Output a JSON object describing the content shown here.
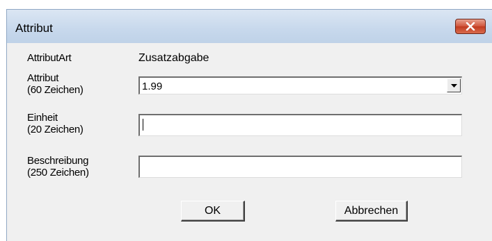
{
  "window": {
    "title": "Attribut",
    "close_icon": "close-icon"
  },
  "form": {
    "attributart_label": "AttributArt",
    "attributart_value": "Zusatzabgabe",
    "attribut_label_line1": "Attribut",
    "attribut_label_line2": "(60 Zeichen)",
    "attribut_selected": "1.99",
    "einheit_label_line1": "Einheit",
    "einheit_label_line2": "(20 Zeichen)",
    "einheit_value": "",
    "beschreibung_label_line1": "Beschreibung",
    "beschreibung_label_line2": "(250 Zeichen)",
    "beschreibung_value": ""
  },
  "buttons": {
    "ok_label": "OK",
    "cancel_label": "Abbrechen"
  },
  "colors": {
    "titlebar": "#c7d8ec",
    "dialog_bg": "#f0f0f0",
    "close_button": "#c94a2e"
  }
}
